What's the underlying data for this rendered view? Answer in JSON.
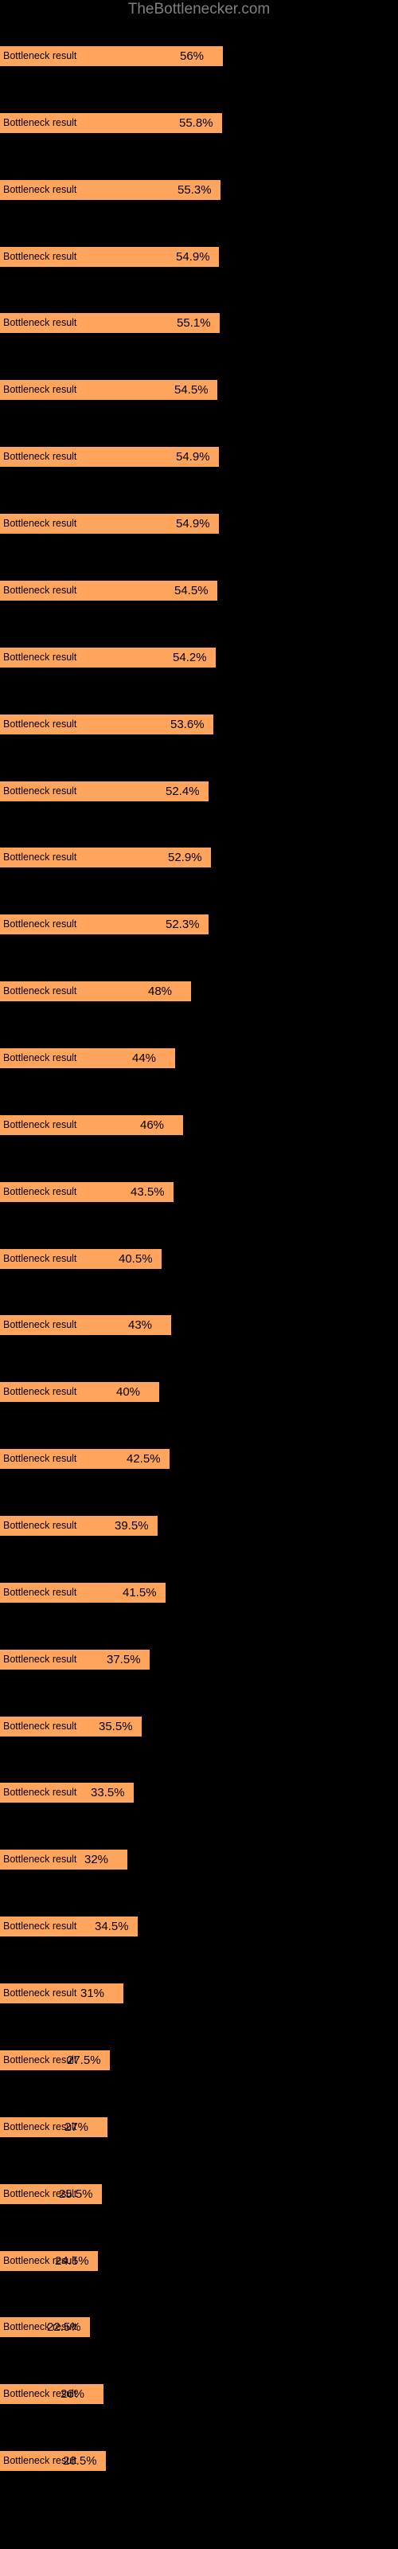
{
  "chart": {
    "title": "TheBottlenecker.com",
    "background_color": "#000000",
    "bar_color": "#FFA45C",
    "title_color": "#808080",
    "text_color": "#000000"
  },
  "chart_data": {
    "type": "bar",
    "orientation": "horizontal",
    "title": "TheBottlenecker.com",
    "xlabel": "",
    "ylabel": "",
    "grid": false,
    "legend": false,
    "xlim": [
      0,
      62
    ],
    "categories": [
      "Bottleneck result",
      "Bottleneck result",
      "Bottleneck result",
      "Bottleneck result",
      "Bottleneck result",
      "Bottleneck result",
      "Bottleneck result",
      "Bottleneck result",
      "Bottleneck result",
      "Bottleneck result",
      "Bottleneck result",
      "Bottleneck result",
      "Bottleneck result",
      "Bottleneck result",
      "Bottleneck result",
      "Bottleneck result",
      "Bottleneck result",
      "Bottleneck result",
      "Bottleneck result",
      "Bottleneck result",
      "Bottleneck result",
      "Bottleneck result",
      "Bottleneck result",
      "Bottleneck result",
      "Bottleneck result",
      "Bottleneck result",
      "Bottleneck result",
      "Bottleneck result",
      "Bottleneck result",
      "Bottleneck result",
      "Bottleneck result",
      "Bottleneck result",
      "Bottleneck result",
      "Bottleneck result",
      "Bottleneck result",
      "Bottleneck result",
      "Bottleneck result"
    ],
    "values": [
      56.0,
      55.8,
      55.3,
      54.9,
      55.1,
      54.5,
      54.9,
      54.9,
      54.5,
      54.2,
      53.6,
      52.4,
      52.9,
      52.3,
      48.0,
      44.0,
      46.0,
      43.5,
      40.5,
      43.0,
      40.0,
      42.5,
      39.5,
      41.5,
      37.5,
      35.5,
      33.5,
      32.0,
      34.5,
      31.0,
      27.5,
      27.0,
      25.5,
      24.5,
      22.5,
      26.0,
      26.5
    ],
    "value_labels": [
      "56%",
      "55.8%",
      "55.3%",
      "54.9%",
      "55.1%",
      "54.5%",
      "54.9%",
      "54.9%",
      "54.5%",
      "54.2%",
      "53.6%",
      "52.4%",
      "52.9%",
      "52.3%",
      "48%",
      "44%",
      "46%",
      "43.5%",
      "40.5%",
      "43%",
      "40%",
      "42.5%",
      "39.5%",
      "41.5%",
      "37.5%",
      "35.5%",
      "33.5%",
      "32%",
      "34.5%",
      "31%",
      "27.5%",
      "27%",
      "25.5%",
      "24.5%",
      "22.5%",
      "26%",
      "26.5%"
    ]
  }
}
